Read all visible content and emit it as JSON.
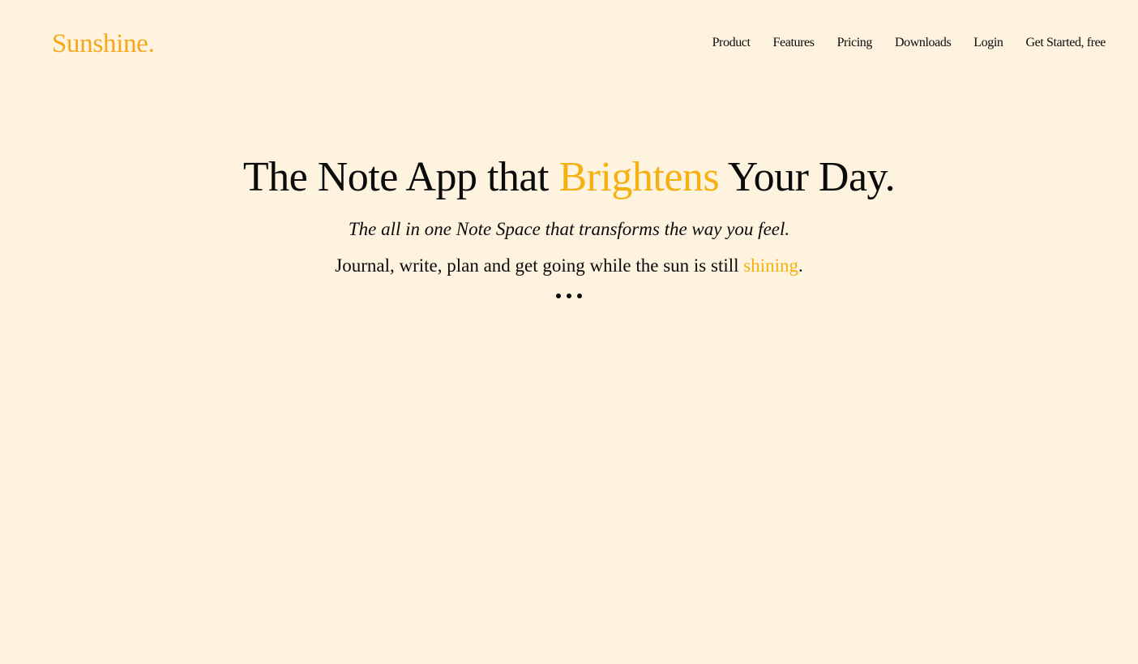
{
  "brand": {
    "name": "Sunshine.",
    "accent_color": "#f6a81a"
  },
  "nav": {
    "items": [
      {
        "label": "Product"
      },
      {
        "label": "Features"
      },
      {
        "label": "Pricing"
      },
      {
        "label": "Downloads"
      },
      {
        "label": "Login"
      },
      {
        "label": "Get Started, free"
      }
    ]
  },
  "hero": {
    "headline_before": "The Note App that ",
    "headline_accent": "Brightens",
    "headline_after": " Your Day.",
    "tagline": "The all in one Note Space that transforms the way you feel.",
    "subline_before": "Journal, write, plan and get going while the sun is still ",
    "subline_accent": "shining",
    "subline_after": ".",
    "loader_icon": "ellipsis-icon"
  },
  "colors": {
    "background": "#fdf3df",
    "text": "#0b0b0b",
    "accent": "#f6b012"
  }
}
